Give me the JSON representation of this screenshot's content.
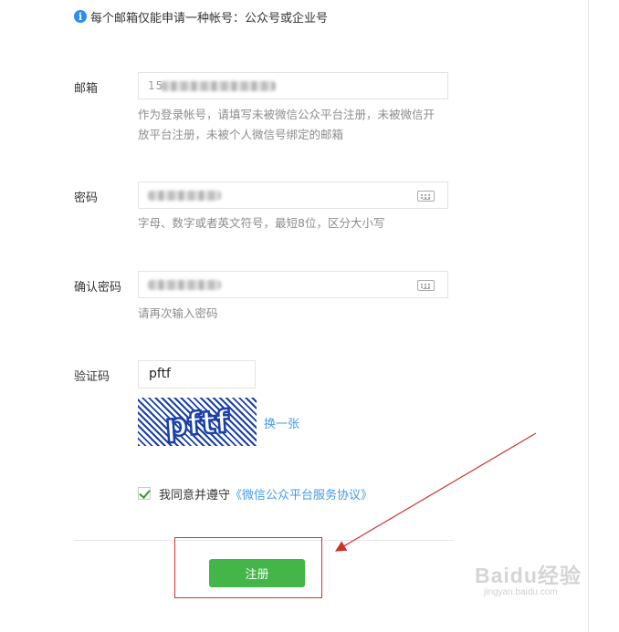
{
  "notice": {
    "icon": "info-icon",
    "text": "每个邮箱仅能申请一种帐号：公众号或企业号"
  },
  "email": {
    "label": "邮箱",
    "value_prefix": "15",
    "hint": "作为登录帐号，请填写未被微信公众平台注册，未被微信开放平台注册，未被个人微信号绑定的邮箱"
  },
  "password": {
    "label": "密码",
    "hint": "字母、数字或者英文符号，最短8位，区分大小写",
    "icon": "keyboard-icon"
  },
  "confirm_password": {
    "label": "确认密码",
    "hint": "请再次输入密码",
    "icon": "keyboard-icon"
  },
  "captcha": {
    "label": "验证码",
    "value": "pftf",
    "refresh_label": "换一张",
    "image_text": "pftf"
  },
  "agreement": {
    "checked": true,
    "prefix": "我同意并遵守",
    "link": "《微信公众平台服务协议》"
  },
  "submit": {
    "label": "注册"
  },
  "watermark": {
    "brand": "Baidu经验",
    "url": "jingyan.baidu.com"
  },
  "colors": {
    "primary_button": "#44b549",
    "link": "#459ae9",
    "annotation": "#d0312d",
    "info": "#2d8cf0"
  }
}
